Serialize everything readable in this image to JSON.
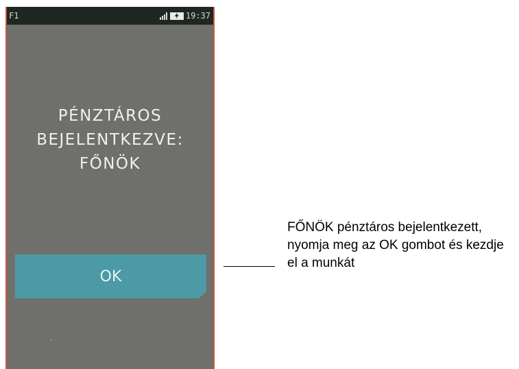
{
  "status_bar": {
    "left_label": "F1",
    "time": "19:37",
    "icons": [
      "signal-icon",
      "battery-charging-icon"
    ]
  },
  "screen": {
    "message_lines": [
      "PÉNZTÁROS",
      "BEJELENTKEZVE:",
      "FŐNÖK"
    ],
    "ok_button_label": "OK"
  },
  "callout": {
    "text": "FŐNÖK pénztáros bejelentkezett, nyomja meg az OK gombot és kezdje el a munkát"
  },
  "colors": {
    "screen_bg": "#6f706b",
    "status_bar_bg": "#1f2623",
    "button_bg": "#4b9aa6",
    "frame_border": "#c8553f"
  }
}
